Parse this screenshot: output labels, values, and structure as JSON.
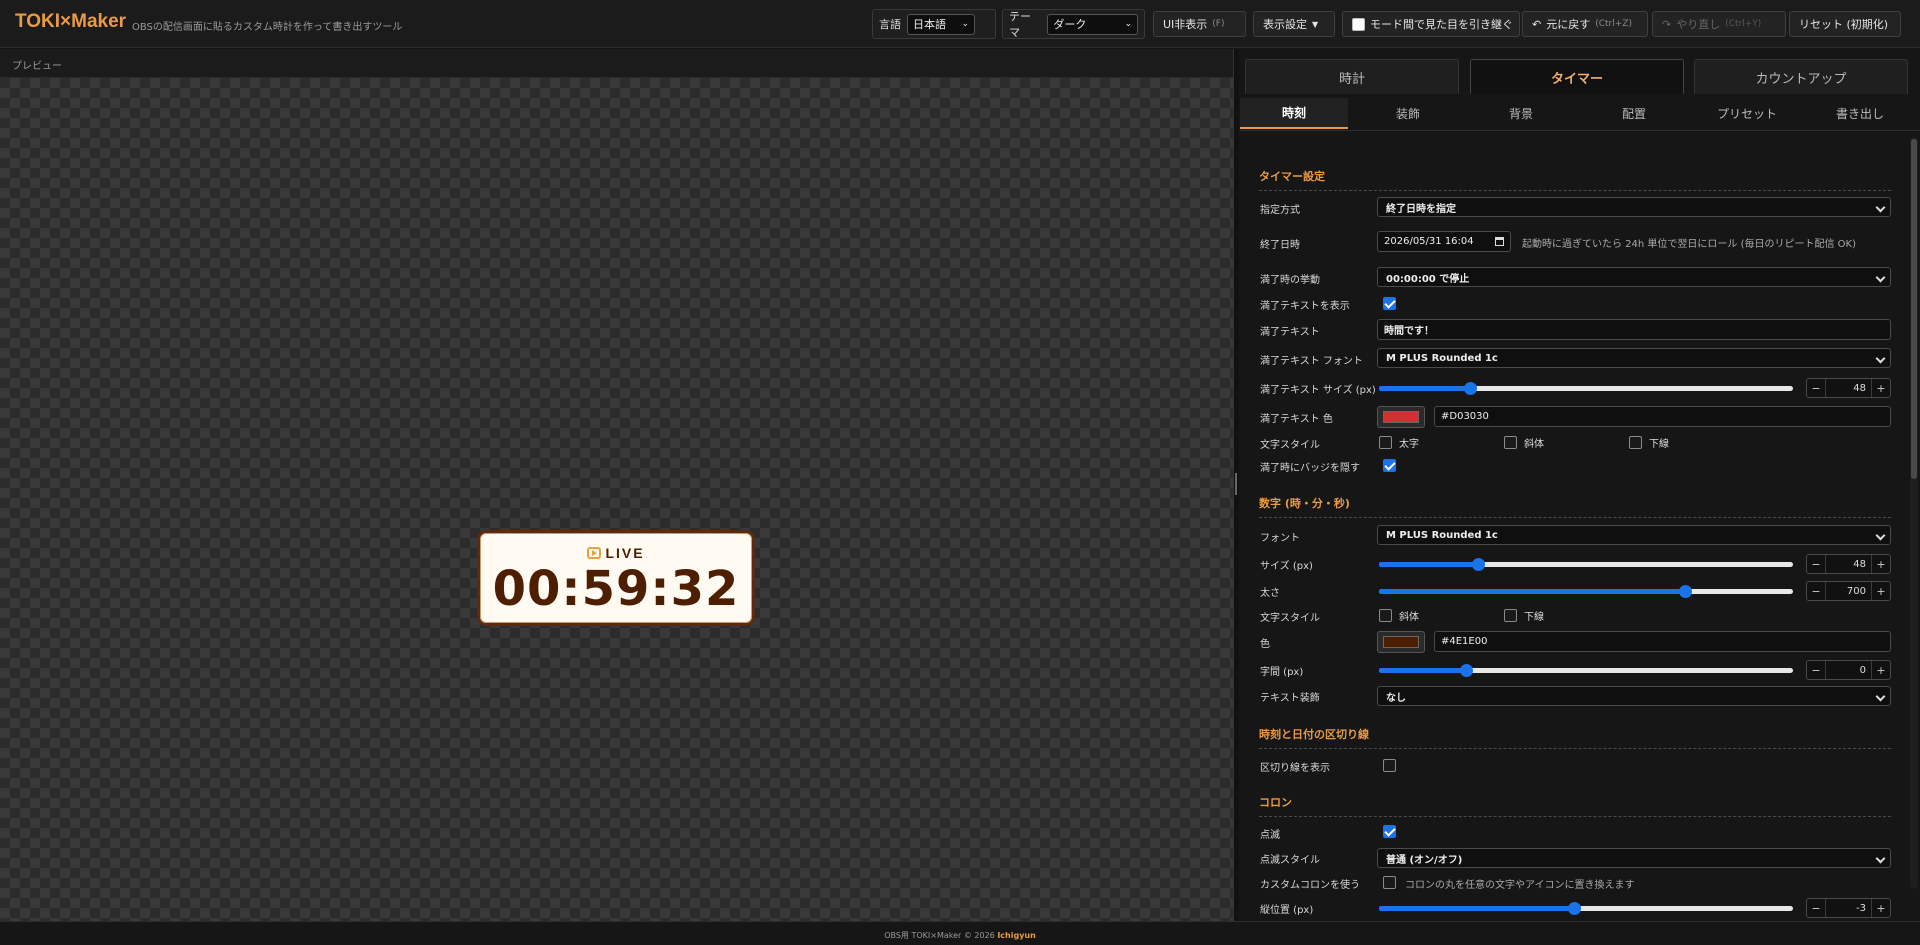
{
  "header": {
    "brand": "TOKI×Maker",
    "tagline": "OBSの配信画面に貼るカスタム時計を作って書き出すツール",
    "language_label": "言語",
    "language_value": "日本語",
    "theme_label": "テーマ",
    "theme_value": "ダーク",
    "hide_ui_label": "UI非表示",
    "hide_ui_shortcut": "(F)",
    "display_settings_label": "表示設定",
    "carry_over_label": "モード間で見た目を引き継ぐ",
    "carry_over_checked": false,
    "undo_label": "元に戻す",
    "undo_shortcut": "(Ctrl+Z)",
    "redo_label": "やり直し",
    "redo_shortcut": "(Ctrl+Y)",
    "reset_label": "リセット (初期化)"
  },
  "preview": {
    "label": "プレビュー",
    "badge_text": "LIVE",
    "time": "00:59:32",
    "text_color": "#4E1E00"
  },
  "tabs": {
    "main": [
      "時計",
      "タイマー",
      "カウントアップ"
    ],
    "main_active": "タイマー",
    "sub": [
      "時刻",
      "装飾",
      "背景",
      "配置",
      "プリセット",
      "書き出し"
    ],
    "sub_active": "時刻"
  },
  "timer": {
    "section": "タイマー設定",
    "method_label": "指定方式",
    "method_value": "終了日時を指定",
    "end_label": "終了日時",
    "end_value": "2026/05/31 16:04",
    "end_hint": "起動時に過ぎていたら 24h 単位で翌日にロール (毎日のリピート配信 OK)",
    "finish_action_label": "満了時の挙動",
    "finish_action_value": "00:00:00 で停止",
    "show_finish_text_label": "満了テキストを表示",
    "show_finish_text": true,
    "finish_text_label": "満了テキスト",
    "finish_text_value": "時間です！",
    "finish_font_label": "満了テキスト フォント",
    "finish_font_value": "M PLUS Rounded 1c",
    "finish_size_label": "満了テキスト サイズ (px)",
    "finish_size_value": "48",
    "finish_size_fraction": 0.22,
    "finish_color_label": "満了テキスト 色",
    "finish_color_value": "#D03030",
    "finish_color": "#D03030",
    "style_label": "文字スタイル",
    "bold_label": "太字",
    "italic_label": "斜体",
    "underline_label": "下線",
    "hide_badge_label": "満了時にバッジを隠す",
    "hide_badge": true
  },
  "digits": {
    "section": "数字 (時・分・秒)",
    "font_label": "フォント",
    "font_value": "M PLUS Rounded 1c",
    "size_label": "サイズ (px)",
    "size_value": "48",
    "size_fraction": 0.24,
    "weight_label": "太さ",
    "weight_value": "700",
    "weight_fraction": 0.74,
    "style_label": "文字スタイル",
    "italic_label": "斜体",
    "underline_label": "下線",
    "color_label": "色",
    "color_value": "#4E1E00",
    "color": "#4E1E00",
    "spacing_label": "字間 (px)",
    "spacing_value": "0",
    "spacing_fraction": 0.21,
    "decoration_label": "テキスト装飾",
    "decoration_value": "なし"
  },
  "separator": {
    "section": "時刻と日付の区切り線",
    "show_label": "区切り線を表示",
    "show": false
  },
  "colon": {
    "section": "コロン",
    "blink_label": "点滅",
    "blink": true,
    "blink_style_label": "点滅スタイル",
    "blink_style_value": "普通 (オン/オフ)",
    "custom_label": "カスタムコロンを使う",
    "custom": false,
    "custom_hint": "コロンの丸を任意の文字やアイコンに置き換えます",
    "vertical_label": "縦位置 (px)",
    "vertical_value": "-3",
    "vertical_fraction": 0.47
  },
  "footer": {
    "text": "OBS用 TOKI×Maker © 2026",
    "author": "Ichigyun"
  }
}
